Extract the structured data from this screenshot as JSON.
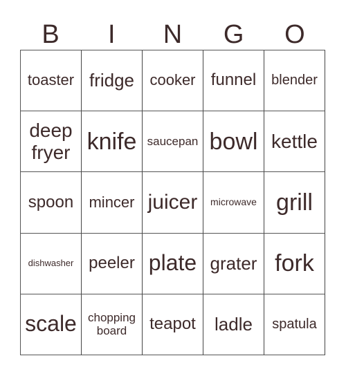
{
  "header": [
    "B",
    "I",
    "N",
    "G",
    "O"
  ],
  "colors": {
    "text": "#3d2a2a",
    "grid": "#555555"
  },
  "cells": [
    "toaster",
    "fridge",
    "cooker",
    "funnel",
    "blender",
    "deep fryer",
    "knife",
    "saucepan",
    "bowl",
    "kettle",
    "spoon",
    "mincer",
    "juicer",
    "microwave",
    "grill",
    "dishwasher",
    "peeler",
    "plate",
    "grater",
    "fork",
    "scale",
    "chopping board",
    "teapot",
    "ladle",
    "spatula"
  ]
}
